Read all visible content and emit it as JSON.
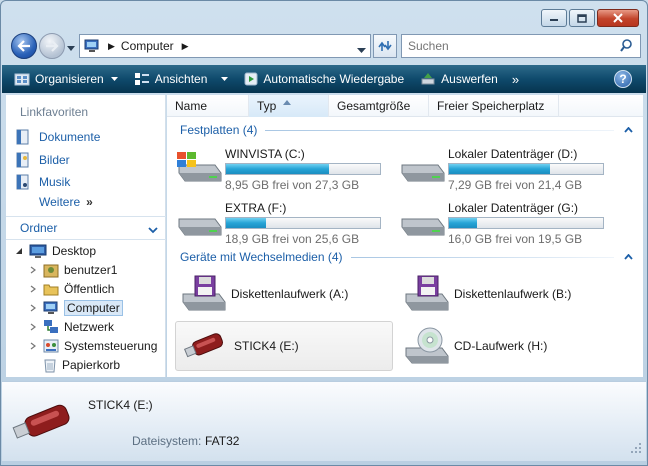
{
  "window": {
    "title": "Computer",
    "colors": {
      "toolbar": "#0f4a6c",
      "link": "#1c5fa8",
      "close": "#c2432a"
    }
  },
  "caption_buttons": {
    "minimize": "minimize-icon",
    "maximize": "maximize-icon",
    "close": "close-icon"
  },
  "nav": {
    "address_text": "Computer",
    "search_placeholder": "Suchen"
  },
  "toolbar": {
    "organize": "Organisieren",
    "views": "Ansichten",
    "autoplay": "Automatische Wiedergabe",
    "eject": "Auswerfen",
    "more": "»"
  },
  "navpane": {
    "favorites_title": "Linkfavoriten",
    "favorites": [
      {
        "label": "Dokumente",
        "icon": "documents-icon"
      },
      {
        "label": "Bilder",
        "icon": "pictures-icon"
      },
      {
        "label": "Musik",
        "icon": "music-icon"
      }
    ],
    "more": "Weitere",
    "more_chevron": "»",
    "folders_title": "Ordner",
    "tree": [
      {
        "label": "Desktop",
        "icon": "desktop-icon"
      },
      {
        "label": "benutzer1",
        "icon": "user-folder-icon"
      },
      {
        "label": "Öffentlich",
        "icon": "folder-icon"
      },
      {
        "label": "Computer",
        "icon": "computer-icon"
      },
      {
        "label": "Netzwerk",
        "icon": "network-icon"
      },
      {
        "label": "Systemsteuerung",
        "icon": "control-panel-icon"
      },
      {
        "label": "Papierkorb",
        "icon": "recycle-bin-icon"
      }
    ]
  },
  "columns": [
    "Name",
    "Typ",
    "Gesamtgröße",
    "Freier Speicherplatz"
  ],
  "groups": {
    "hard_drives": "Festplatten (4)",
    "removable": "Geräte mit Wechselmedien (4)"
  },
  "drives": [
    {
      "name": "WINVISTA (C:)",
      "free": "8,95 GB frei von 27,3 GB",
      "used_fraction": 0.672,
      "icon": "windows-drive-icon"
    },
    {
      "name": "Lokaler Datenträger (D:)",
      "free": "7,29 GB frei von 21,4 GB",
      "used_fraction": 0.659,
      "icon": "hard-drive-icon"
    },
    {
      "name": "EXTRA (F:)",
      "free": "18,9 GB frei von 25,6 GB",
      "used_fraction": 0.262,
      "icon": "hard-drive-icon"
    },
    {
      "name": "Lokaler Datenträger (G:)",
      "free": "16,0 GB frei von 19,5 GB",
      "used_fraction": 0.179,
      "icon": "hard-drive-icon"
    }
  ],
  "removable": [
    {
      "name": "Diskettenlaufwerk (A:)",
      "icon": "floppy-drive-icon"
    },
    {
      "name": "Diskettenlaufwerk (B:)",
      "icon": "floppy-drive-icon"
    },
    {
      "name": "STICK4 (E:)",
      "icon": "usb-stick-icon"
    },
    {
      "name": "CD-Laufwerk (H:)",
      "icon": "cd-drive-icon"
    }
  ],
  "details": {
    "title": "STICK4 (E:)",
    "filesystem_label": "Dateisystem:",
    "filesystem_value": "FAT32"
  }
}
